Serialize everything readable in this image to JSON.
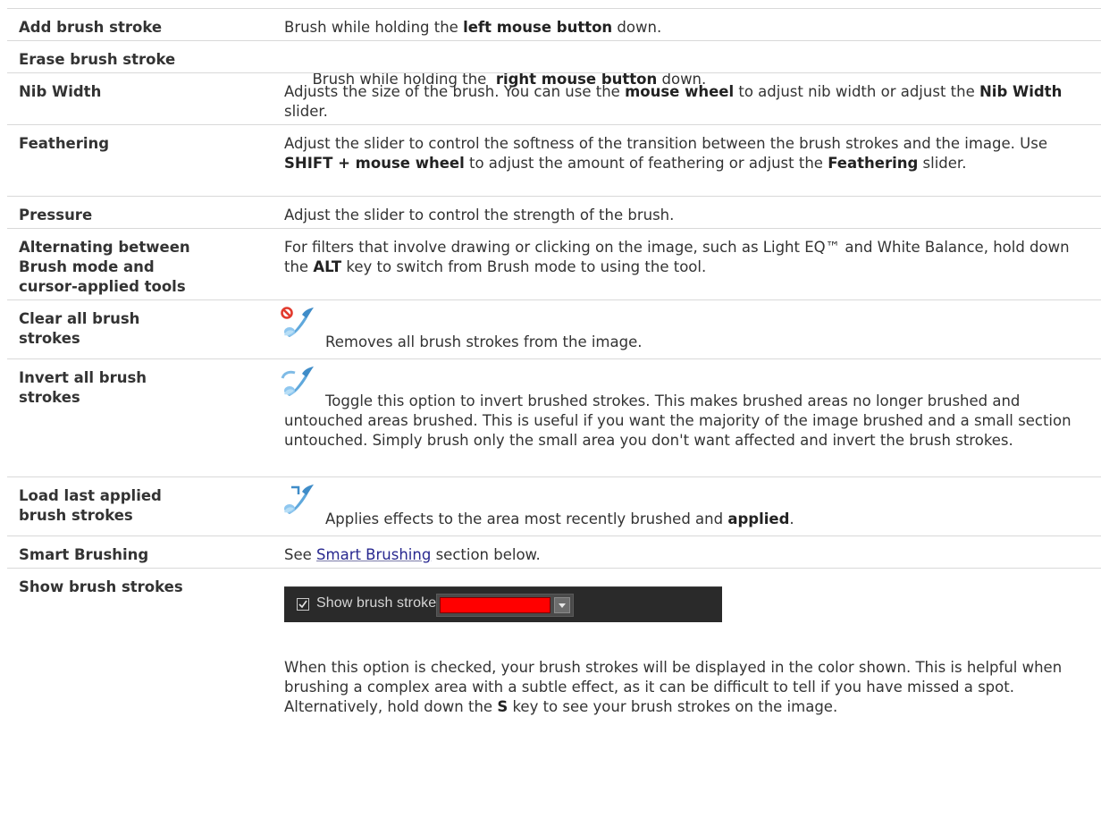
{
  "rows": [
    {
      "key": "Add brush stroke",
      "desc": [
        "Brush while holding the ",
        {
          "b": "left mouse button"
        },
        " down."
      ]
    },
    {
      "key": "Erase brush stroke",
      "desc": [
        "Brush while holding the  ",
        {
          "b": "right mouse button"
        },
        " down."
      ]
    },
    {
      "key": "Nib Width",
      "desc": [
        "Adjusts the size of the brush. You can use the ",
        {
          "b": "mouse wheel"
        },
        " to adjust nib width or adjust the ",
        {
          "b": "Nib Width"
        },
        " slider."
      ]
    },
    {
      "key": "Feathering",
      "desc": [
        "Adjust the slider to control the softness of the transition between the brush strokes and the image. Use ",
        {
          "b": "SHIFT + mouse wheel"
        },
        " to adjust the amount of feathering or adjust the ",
        {
          "b": "Feathering"
        },
        " slider."
      ]
    },
    {
      "key": "Pressure",
      "desc": [
        "Adjust the slider to control the strength of the brush."
      ]
    },
    {
      "key": "Alternating between Brush mode and cursor-applied tools",
      "desc": [
        "For filters that involve drawing or clicking on the image, such as Light EQ™ and White Balance, hold down the ",
        {
          "b": "ALT"
        },
        " key to switch from Brush mode to using the tool."
      ]
    },
    {
      "key": "Clear all brush strokes",
      "icon": "clear-brush-icon",
      "desc": [
        "Removes all brush strokes from the image."
      ]
    },
    {
      "key": "Invert all brush strokes",
      "icon": "invert-brush-icon",
      "desc": [
        "Toggle this option to invert brushed strokes. This makes brushed areas no longer brushed and untouched areas brushed. This is useful if you want the majority of the image brushed and a small section untouched. Simply brush only the small area you don't want affected and invert the brush strokes."
      ]
    },
    {
      "key": "Load last applied brush strokes",
      "icon": "load-brush-icon",
      "desc": [
        "Applies effects to the area most recently brushed and ",
        {
          "b": "applied"
        },
        "."
      ]
    },
    {
      "key": "Smart Brushing",
      "desc": [
        "See ",
        {
          "link": "Smart Brushing"
        },
        " section below."
      ]
    },
    {
      "key": "Show brush strokes",
      "desc": [
        "When this option is checked, your brush strokes will be displayed in the color shown. This is helpful when brushing a complex area with a subtle effect, as it can be difficult to tell if you have missed a spot. Alternatively, hold down the ",
        {
          "b": "S"
        },
        " key to see your brush strokes on the image."
      ]
    }
  ],
  "widget": {
    "checkbox_label": "Show brush strokes",
    "checked": true,
    "swatch_color": "#ff0000"
  }
}
